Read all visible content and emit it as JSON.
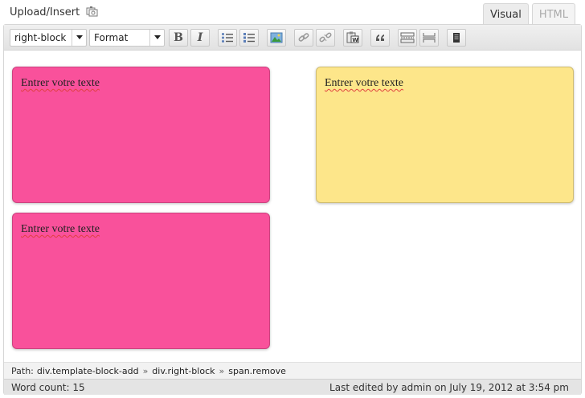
{
  "upload": {
    "label": "Upload/Insert",
    "icon": "media-icon"
  },
  "tabs": [
    {
      "label": "Visual",
      "active": true
    },
    {
      "label": "HTML",
      "active": false
    }
  ],
  "toolbar": {
    "style_select": "right-block",
    "format_select": "Format",
    "bold_label": "B",
    "italic_label": "I",
    "icons": [
      "bullet-list-icon",
      "numbered-list-icon",
      "insert-image-icon",
      "link-icon",
      "unlink-icon",
      "paste-word-icon",
      "blockquote-icon",
      "insert-more-icon",
      "page-break-icon",
      "template-icon"
    ]
  },
  "blocks": [
    {
      "text": "Entrer votre texte",
      "color": "#f9519b"
    },
    {
      "text": "Entrer votre texte",
      "color": "#fde68a"
    },
    {
      "text": "Entrer votre texte",
      "color": "#f9519b"
    }
  ],
  "path": {
    "label": "Path:",
    "crumbs": [
      "div.template-block-add",
      "div.right-block",
      "span.remove"
    ],
    "separator": "»"
  },
  "status": {
    "word_count": "Word count: 15",
    "last_edited": "Last edited by admin on July 19, 2012 at 3:54 pm"
  }
}
